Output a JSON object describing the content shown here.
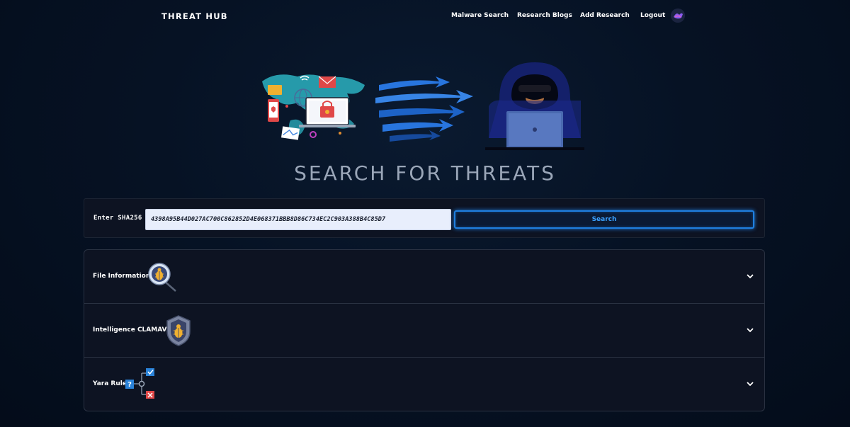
{
  "nav": {
    "brand": "THREAT HUB",
    "links": [
      {
        "label": "Malware Search"
      },
      {
        "label": "Research Blogs"
      },
      {
        "label": "Add Research"
      },
      {
        "label": "Logout"
      }
    ]
  },
  "hero": {
    "title": "SEARCH FOR THREATS"
  },
  "search": {
    "label": "Enter SHA256",
    "value": "4398A95B44D027AC700C862852D4E068371BBB8D86C734EC2C903A388B4C85D7",
    "button_label": "Search"
  },
  "accordion": {
    "items": [
      {
        "label": "File Information",
        "icon": "bug-magnifier-icon"
      },
      {
        "label": "Intelligence CLAMAV",
        "icon": "bug-shield-icon"
      },
      {
        "label": "Yara Rule",
        "icon": "rule-flow-icon"
      }
    ]
  },
  "colors": {
    "accent": "#1f7fe0",
    "background": "#061224",
    "panel": "#0d1322"
  }
}
